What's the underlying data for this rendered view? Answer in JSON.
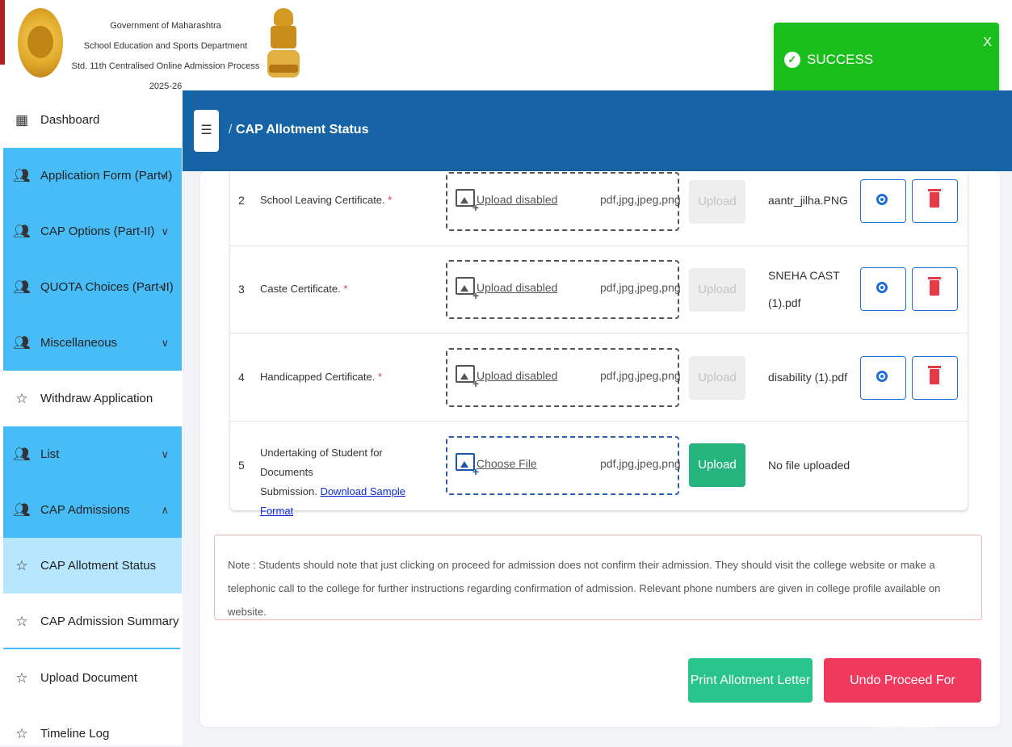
{
  "header": {
    "line1": "Government of Maharashtra",
    "line2": "School Education and Sports Department",
    "line3": "Std. 11th Centralised Online Admission Process 2025-26"
  },
  "toast": {
    "message": "SUCCESS",
    "close": "X",
    "color": "#1bbf1b"
  },
  "sidebar": {
    "items": [
      {
        "label": "Dashboard",
        "icon": "dashboard-icon"
      },
      {
        "label": "Application Form (Part-I)",
        "icon": "users-icon"
      },
      {
        "label": "CAP Options (Part-II)",
        "icon": "users-icon"
      },
      {
        "label": "QUOTA Choices (Part-II)",
        "icon": "users-icon"
      },
      {
        "label": "Miscellaneous",
        "icon": "users-icon"
      },
      {
        "label": "Withdraw Application",
        "icon": "star-icon"
      },
      {
        "label": "List",
        "icon": "users-icon"
      },
      {
        "label": "CAP Admissions",
        "icon": "users-icon"
      },
      {
        "label": "CAP Allotment Status",
        "icon": "star-icon"
      },
      {
        "label": "CAP Admission Summary",
        "icon": "star-icon"
      },
      {
        "label": "Upload Document",
        "icon": "star-icon"
      },
      {
        "label": "Timeline Log",
        "icon": "star-icon"
      }
    ]
  },
  "topbar": {
    "breadcrumb_sep": "/",
    "breadcrumb": "CAP Allotment Status",
    "color": "#1663a5"
  },
  "documents": [
    {
      "no": "2",
      "name": "School Leaving Certificate.",
      "required": "*",
      "upload_text": "Upload disabled",
      "types": "pdf,jpg,jpeg,png",
      "button": "Upload",
      "file_line1": "aantr_jilha.PNG",
      "file_line2": ""
    },
    {
      "no": "3",
      "name": "Caste Certificate.",
      "required": "*",
      "upload_text": "Upload disabled",
      "types": "pdf,jpg,jpeg,png",
      "button": "Upload",
      "file_line1": "SNEHA CAST",
      "file_line2": "(1).pdf"
    },
    {
      "no": "4",
      "name": "Handicapped Certificate.",
      "required": "*",
      "upload_text": "Upload disabled",
      "types": "pdf,jpg,jpeg,png",
      "button": "Upload",
      "file_line1": "disability (1).pdf",
      "file_line2": ""
    },
    {
      "no": "5",
      "name_line1": "Undertaking of Student for Documents",
      "name_line2": "Submission.",
      "link": "Download Sample Format",
      "choose": "Choose",
      "file_word": "File",
      "types": "pdf,jpg,jpeg,png",
      "button": "Upload",
      "file_line1": "No file uploaded"
    }
  ],
  "note": "Note : Students should note that just clicking on proceed for admission does not confirm their admission. They should visit the college website or make a telephonic call to the college for further instructions regarding confirmation of admission. Relevant phone numbers are given in college profile available on website.",
  "actions": {
    "print": "Print Allotment Letter",
    "undo": "Undo Proceed For Admission"
  }
}
